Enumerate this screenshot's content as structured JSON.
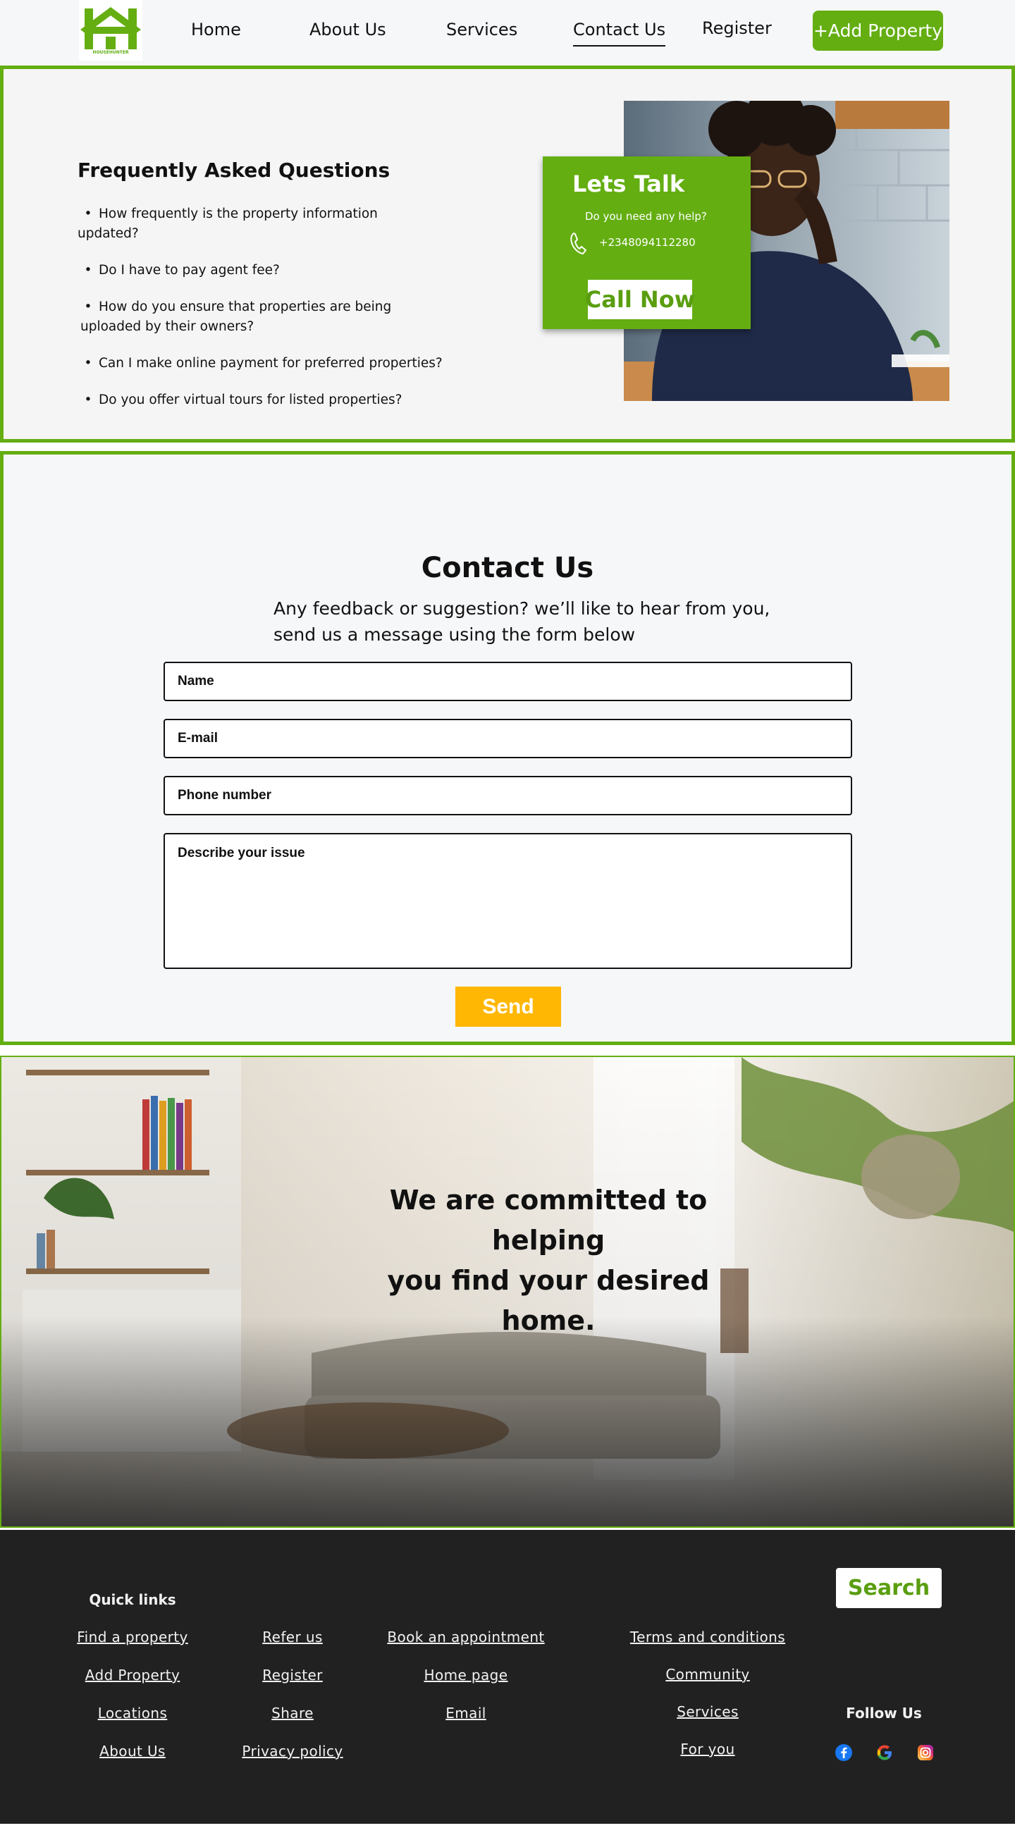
{
  "nav": {
    "logo_text": "HOUSEHUNTER",
    "links": [
      {
        "label": "Home"
      },
      {
        "label": "About Us"
      },
      {
        "label": "Services"
      },
      {
        "label": "Contact Us"
      },
      {
        "label": "Register"
      }
    ],
    "cta": "+Add Property"
  },
  "faq": {
    "title": "Frequently Asked Questions",
    "items": [
      {
        "line1": "How frequently is the property information",
        "line2": "updated?"
      },
      {
        "line1": "Do I have to pay agent fee?",
        "line2": ""
      },
      {
        "line1": "How do you ensure that properties are being",
        "line2": "uploaded by their owners?"
      },
      {
        "line1": "Can I make online payment for preferred properties?",
        "line2": ""
      },
      {
        "line1": "Do you offer virtual tours for listed properties?",
        "line2": ""
      }
    ]
  },
  "talk": {
    "title": "Lets Talk",
    "subtitle": "Do you need any help?",
    "phone": "+2348094112280",
    "button": "Call Now"
  },
  "contact": {
    "title": "Contact Us",
    "subtitle_line1": "Any feedback or suggestion? we’ll like to hear from you,",
    "subtitle_line2": "send us a message using the form below",
    "name_placeholder": "Name",
    "email_placeholder": "E-mail",
    "phone_placeholder": "Phone number",
    "issue_placeholder": "Describe your issue",
    "send": "Send"
  },
  "hero": {
    "line1": "We are committed to helping",
    "line2": "you find your desired",
    "line3": "home."
  },
  "footer": {
    "quick_links": "Quick links",
    "search": "Search",
    "follow_us": "Follow Us",
    "col1": [
      "Find a property",
      "Add Property",
      "Locations",
      "About Us"
    ],
    "col2": [
      "Refer us",
      "Register",
      "Share",
      "Privacy policy"
    ],
    "col3": [
      "Book an appointment",
      "Home page",
      "Email"
    ],
    "col4": [
      "Terms and conditions",
      "Community",
      "Services",
      "For you"
    ]
  },
  "colors": {
    "brand_green": "#64ae12",
    "send_yellow": "#ffb703",
    "footer_bg": "#212121"
  }
}
